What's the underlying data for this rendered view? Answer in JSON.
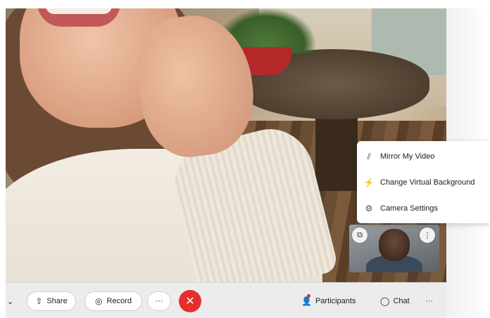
{
  "menu": {
    "items": [
      {
        "label": "Mirror My Video",
        "icon": "mirror-icon"
      },
      {
        "label": "Change Virtual Background",
        "icon": "magic-wand-icon"
      },
      {
        "label": "Camera Settings",
        "icon": "gear-icon"
      }
    ]
  },
  "toolbar": {
    "share_label": "Share",
    "record_label": "Record",
    "more_label": "···",
    "participants_label": "Participants",
    "chat_label": "Chat",
    "overflow_label": "···",
    "end_call_color": "#e3302f"
  }
}
